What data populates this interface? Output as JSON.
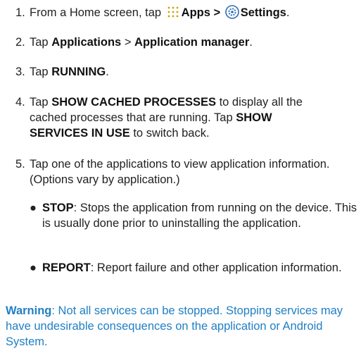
{
  "steps": [
    {
      "num": "1.",
      "t1": "From a Home screen, tap",
      "b1": "Apps",
      "sep": ">",
      "b2": "Settings",
      "end": "."
    },
    {
      "num": "2.",
      "t1": "Tap",
      "b1": "Applications",
      "sep": ">",
      "b2": "Application manager",
      "end": "."
    },
    {
      "num": "3.",
      "t1": "Tap",
      "b1": "RUNNING",
      "end": "."
    },
    {
      "num": "4.",
      "t1": "Tap",
      "b1": "SHOW CACHED PROCESSES",
      "t2": "to display all the cached processes that are running. Tap",
      "b2": "SHOW SERVICES IN USE",
      "t3": "to switch back."
    },
    {
      "num": "5.",
      "text": "Tap one of the applications to view application information. (Options vary by application.)"
    }
  ],
  "bullets": [
    {
      "label": "STOP",
      "text": ": Stops the application from running on the device. This is usually done prior to uninstalling the application."
    },
    {
      "label": "REPORT",
      "text": ": Report failure and other application information."
    }
  ],
  "warning": {
    "label": "Warning",
    "text": ": Not all services can be stopped. Stopping services may have undesirable consequences on the application or Android System."
  },
  "icons": {
    "apps": "apps-grid-icon",
    "settings": "settings-gear-icon"
  },
  "colors": {
    "text": "#222222",
    "accent": "#1f7fc4",
    "settings_icon": "#2f6fb3"
  }
}
